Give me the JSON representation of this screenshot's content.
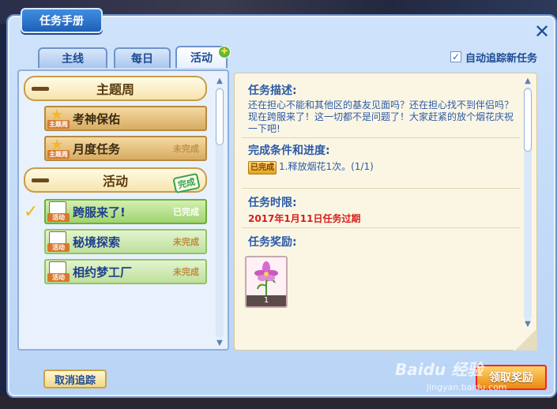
{
  "window": {
    "title": "任务手册",
    "close_icon": "close-icon"
  },
  "tabs": [
    {
      "label": "主线",
      "active": false
    },
    {
      "label": "每日",
      "active": false
    },
    {
      "label": "活动",
      "active": true
    }
  ],
  "auto_track": {
    "label": "自动追踪新任务",
    "checked": true
  },
  "quest_list": {
    "categories": [
      {
        "label": "主题周",
        "expanded": true,
        "items": [
          {
            "title": "考神保佑",
            "tag": "主题周",
            "status": ""
          },
          {
            "title": "月度任务",
            "tag": "主题周",
            "status": "未完成"
          }
        ]
      },
      {
        "label": "活动",
        "expanded": true,
        "stamp": "完成",
        "items": [
          {
            "title": "跨服来了!",
            "tag": "活动",
            "status": "已完成",
            "selected": true
          },
          {
            "title": "秘境探索",
            "tag": "活动",
            "status": "未完成"
          },
          {
            "title": "相约梦工厂",
            "tag": "活动",
            "status": "未完成"
          }
        ]
      }
    ]
  },
  "details": {
    "description_title": "任务描述:",
    "description": "还在担心不能和其他区的基友见面吗？还在担心找不到伴侣吗？现在跨服来了！这一切都不是问题了！大家赶紧的放个烟花庆祝一下吧!",
    "progress_title": "完成条件和进度:",
    "progress_badge": "已完成",
    "progress_text": "1.释放烟花1次。(1/1)",
    "deadline_title": "任务时限:",
    "deadline": "2017年1月11日任务过期",
    "reward_title": "任务奖励:",
    "reward_count": "1",
    "reward_icon": "flower-icon"
  },
  "buttons": {
    "untrack": "取消追踪",
    "claim": "领取奖励"
  },
  "watermark": {
    "text": "Baidu 经验",
    "url": "jingyan.baidu.com"
  },
  "colors": {
    "panel": "#b9d4f6",
    "accent": "#2b5aa8",
    "deadline": "#d4201b",
    "claim_border": "#ff2020"
  }
}
